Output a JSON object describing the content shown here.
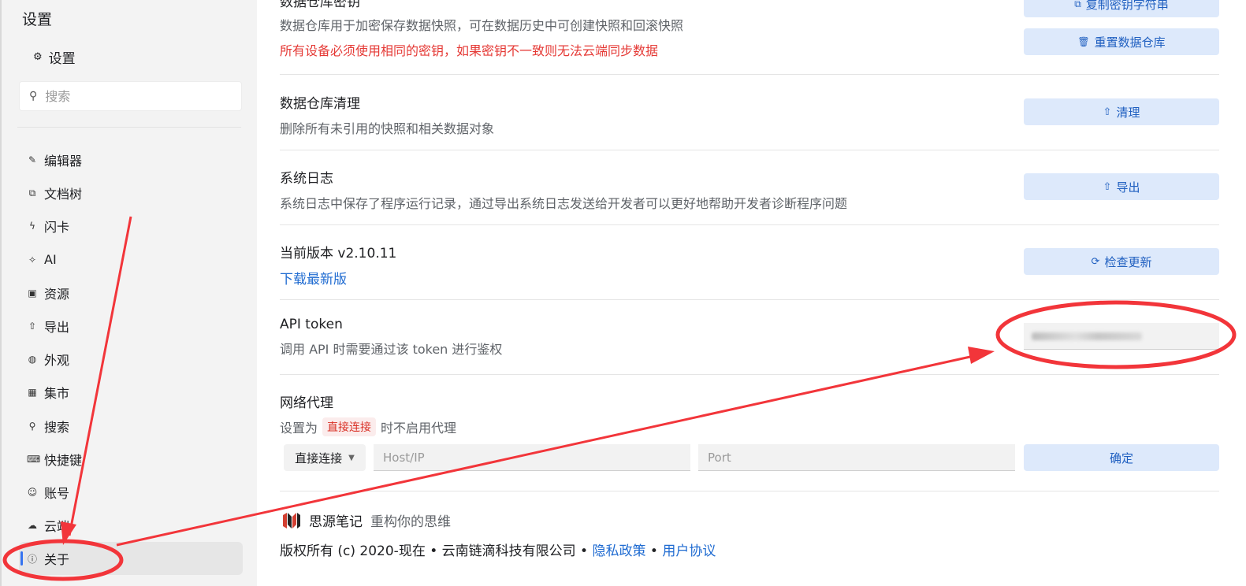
{
  "sidebar": {
    "title": "设置",
    "setting_label": "设置",
    "search_placeholder": "搜索",
    "items": [
      {
        "label": "编辑器",
        "icon": "pencil-icon",
        "glyph": "✎"
      },
      {
        "label": "文档树",
        "icon": "tree-icon",
        "glyph": "⧉"
      },
      {
        "label": "闪卡",
        "icon": "flash-icon",
        "glyph": "ϟ"
      },
      {
        "label": "AI",
        "icon": "sparkle-icon",
        "glyph": "✧"
      },
      {
        "label": "资源",
        "icon": "image-icon",
        "glyph": "▣"
      },
      {
        "label": "导出",
        "icon": "upload-icon",
        "glyph": "⇧"
      },
      {
        "label": "外观",
        "icon": "palette-icon",
        "glyph": "◍"
      },
      {
        "label": "集市",
        "icon": "store-icon",
        "glyph": "▦"
      },
      {
        "label": "搜索",
        "icon": "search-icon",
        "glyph": "⚲"
      },
      {
        "label": "快捷键",
        "icon": "keyboard-icon",
        "glyph": "⌨"
      },
      {
        "label": "账号",
        "icon": "user-icon",
        "glyph": "☺"
      },
      {
        "label": "云端",
        "icon": "cloud-icon",
        "glyph": "☁"
      },
      {
        "label": "关于",
        "icon": "info-icon",
        "glyph": "ⓘ",
        "active": true
      }
    ]
  },
  "main": {
    "repo_key": {
      "title": "数据仓库密钥",
      "desc": "数据仓库用于加密保存数据快照，可在数据历史中可创建快照和回滚快照",
      "warn": "所有设备必须使用相同的密钥，如果密钥不一致则无法云端同步数据",
      "copy_button": "复制密钥字符串",
      "reset_button": "重置数据仓库"
    },
    "repo_clean": {
      "title": "数据仓库清理",
      "desc": "删除所有未引用的快照和相关数据对象",
      "button": "清理"
    },
    "syslog": {
      "title": "系统日志",
      "desc": "系统日志中保存了程序运行记录，通过导出系统日志发送给开发者可以更好地帮助开发者诊断程序问题",
      "button": "导出"
    },
    "version": {
      "title": "当前版本 v2.10.11",
      "link": "下载最新版",
      "button": "检查更新"
    },
    "api_token": {
      "title": "API token",
      "desc": "调用 API 时需要通过该 token 进行鉴权"
    },
    "proxy": {
      "title": "网络代理",
      "desc_prefix": "设置为",
      "desc_chip": "直接连接",
      "desc_suffix": "时不启用代理",
      "select_value": "直接连接",
      "host_placeholder": "Host/IP",
      "port_placeholder": "Port",
      "confirm_button": "确定"
    },
    "footer": {
      "app_name": "思源笔记",
      "slogan": "重构你的思维",
      "copyright": "版权所有 (c) 2020-现在 • 云南链滴科技有限公司 •",
      "privacy": "隐私政策",
      "dot": "•",
      "terms": "用户协议"
    }
  },
  "colors": {
    "accent": "#3573f0",
    "button_bg": "#dde9fb",
    "warn": "#e53935",
    "annotation": "#f2353a"
  }
}
